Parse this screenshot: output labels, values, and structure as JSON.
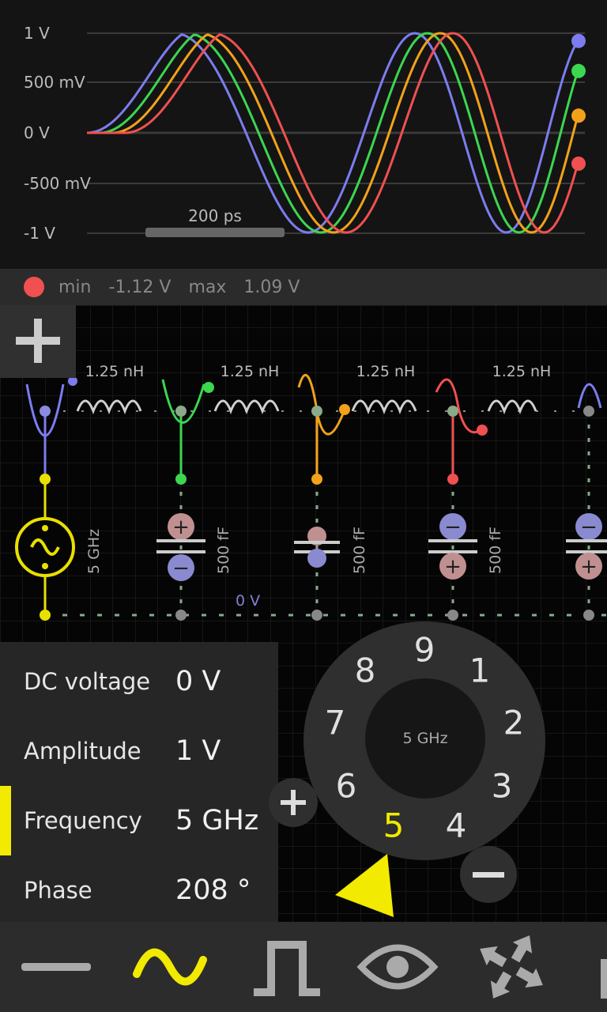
{
  "scope": {
    "y_ticks": [
      "1 V",
      "500 mV",
      "0 V",
      "-500 mV",
      "-1 V"
    ],
    "time_scale": "200 ps",
    "traces": [
      {
        "name": "",
        "color": "#7c7cf0"
      },
      {
        "name": "",
        "color": "#3cd650"
      },
      {
        "name": "",
        "color": "#f2a21a"
      },
      {
        "name": "",
        "color": "#f05050"
      }
    ]
  },
  "status": {
    "min_label": "min",
    "min_value": "-1.12 V",
    "max_label": "max",
    "max_value": "1.09 V",
    "dot_color": "#f05050"
  },
  "circuit": {
    "inductors": [
      "1.25 nH",
      "1.25 nH",
      "1.25 nH",
      "1.25 nH"
    ],
    "capacitors": [
      "500 fF",
      "500 fF",
      "500 fF"
    ],
    "source_label": "5 GHz",
    "ground_label": "0 V"
  },
  "add_button_icon": "plus-icon",
  "params": [
    {
      "label": "DC voltage",
      "value": "0 V"
    },
    {
      "label": "Amplitude",
      "value": "1 V"
    },
    {
      "label": "Frequency",
      "value": "5 GHz"
    },
    {
      "label": "Phase",
      "value": "208 °"
    }
  ],
  "selected_param": "Frequency",
  "dial": {
    "center_label": "5 GHz",
    "digits": [
      "9",
      "1",
      "2",
      "3",
      "4",
      "5",
      "6",
      "7",
      "8"
    ],
    "selected_digit": "5"
  },
  "toolbar": {
    "icons": [
      "dc-source-icon",
      "sine-source-icon",
      "pulse-source-icon",
      "eye-icon",
      "arrows-icon"
    ],
    "active": "sine-source-icon",
    "accent": "#f2ea00"
  }
}
